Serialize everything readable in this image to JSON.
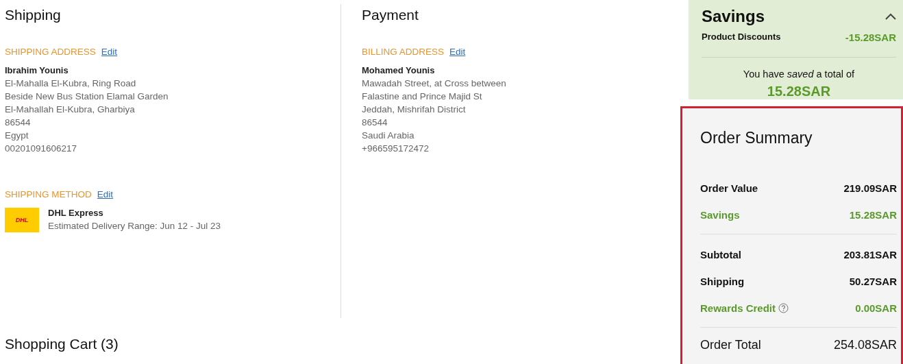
{
  "shipping": {
    "title": "Shipping",
    "address": {
      "label": "SHIPPING ADDRESS",
      "edit": "Edit",
      "name": "Ibrahim Younis",
      "lines": [
        "El-Mahalla El-Kubra, Ring Road",
        "Beside New Bus Station Elamal Garden",
        "El-Mahallah El-Kubra, Gharbiya",
        "86544",
        "Egypt",
        "00201091606217"
      ]
    },
    "method": {
      "label": "SHIPPING METHOD",
      "edit": "Edit",
      "carrier": "DHL Express",
      "logo": "DHL",
      "estimate": "Estimated Delivery Range: Jun 12 - Jul 23"
    }
  },
  "payment": {
    "title": "Payment",
    "address": {
      "label": "BILLING ADDRESS",
      "edit": "Edit",
      "name": "Mohamed Younis",
      "lines": [
        "Mawadah Street, at Cross between",
        "Falastine and Prince Majid St",
        "Jeddah, Mishrifah District",
        "86544",
        "Saudi Arabia",
        "+966595172472"
      ]
    }
  },
  "cart": {
    "title": "Shopping Cart (3)"
  },
  "savings": {
    "title": "Savings",
    "expanded": true,
    "rows": [
      {
        "label": "Product Discounts",
        "value": "-15.28SAR"
      }
    ],
    "note": "You have *saved* a total of",
    "total": "15.28SAR"
  },
  "summary": {
    "title": "Order Summary",
    "groups": [
      [
        {
          "label": "Order Value",
          "value": "219.09SAR",
          "kind": "plain"
        },
        {
          "label": "Savings",
          "value": "15.28SAR",
          "kind": "savings"
        }
      ],
      [
        {
          "label": "Subtotal",
          "value": "203.81SAR",
          "kind": "plain"
        },
        {
          "label": "Shipping",
          "value": "50.27SAR",
          "kind": "plain"
        },
        {
          "label": "Rewards Credit",
          "value": "0.00SAR",
          "kind": "credit"
        }
      ],
      [
        {
          "label": "Order Total",
          "value": "254.08SAR",
          "kind": "total"
        }
      ]
    ]
  }
}
